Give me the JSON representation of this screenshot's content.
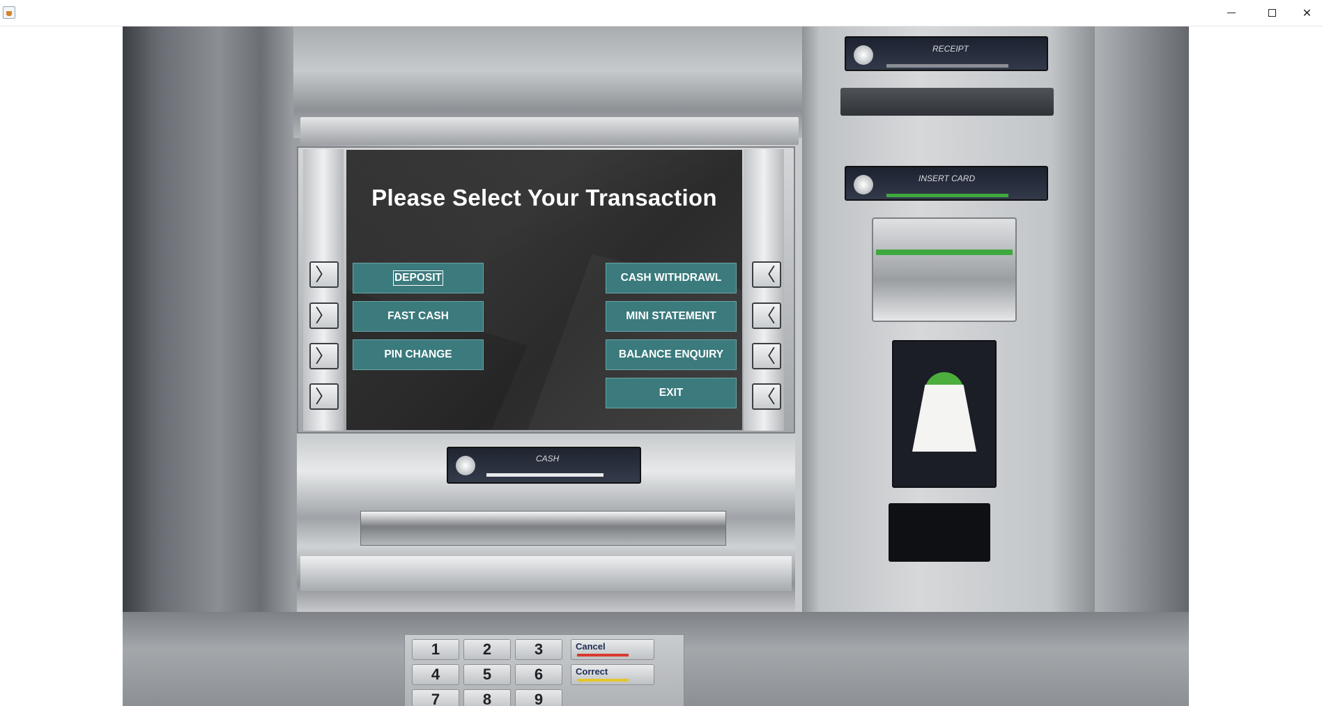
{
  "window": {
    "title": "",
    "controls": {
      "minimize": "minimize",
      "maximize": "maximize",
      "close": "✕"
    }
  },
  "screen": {
    "title": "Please Select Your Transaction",
    "left_buttons": [
      {
        "label": "DEPOSIT",
        "focused": true
      },
      {
        "label": "FAST CASH",
        "focused": false
      },
      {
        "label": "PIN CHANGE",
        "focused": false
      }
    ],
    "right_buttons": [
      {
        "label": "CASH WITHDRAWL"
      },
      {
        "label": "MINI STATEMENT"
      },
      {
        "label": "BALANCE ENQUIRY"
      },
      {
        "label": "EXIT"
      }
    ],
    "button_color": "#3b7a7d",
    "background_color": "#2e2e2e"
  },
  "side_keys": {
    "left_glyph": "〉",
    "right_glyph": "〈"
  },
  "keypad": {
    "digits": [
      "1",
      "2",
      "3",
      "4",
      "5",
      "6",
      "7",
      "8",
      "9"
    ],
    "function_keys": [
      {
        "label": "Cancel",
        "stripe": "#d83a2e"
      },
      {
        "label": "Correct",
        "stripe": "#e4c62a"
      }
    ]
  },
  "machine_labels": {
    "receipt": "RECEIPT",
    "insert_card": "INSERT CARD",
    "cash": "CASH"
  },
  "accent_colors": {
    "green": "#3fa83f",
    "red": "#d83a2e",
    "yellow": "#e4c62a"
  }
}
